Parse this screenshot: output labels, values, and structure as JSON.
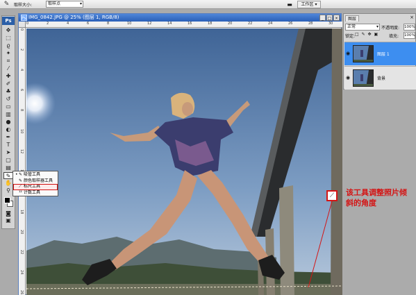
{
  "options_bar": {
    "tool_icon": "eyedropper-icon",
    "sample_size_label": "取样大小:",
    "sample_size_value": "取样点",
    "workspace_label": "工作区",
    "workspace_icon": "workspace-icon"
  },
  "toolbox": {
    "logo": "Ps",
    "tools": [
      "move-icon",
      "marquee-icon",
      "lasso-icon",
      "magic-wand-icon",
      "crop-icon",
      "slice-icon",
      "healing-brush-icon",
      "brush-icon",
      "clone-stamp-icon",
      "history-brush-icon",
      "eraser-icon",
      "gradient-icon",
      "blur-icon",
      "dodge-icon",
      "pen-icon",
      "type-icon",
      "path-select-icon",
      "shape-icon",
      "notes-icon",
      "eyedropper-icon",
      "hand-icon",
      "zoom-icon"
    ],
    "foreground_color": "#000000",
    "background_color": "#ffffff"
  },
  "flyout": {
    "items": [
      {
        "label": "吸管工具",
        "icon": "eyedropper-icon",
        "selected": false
      },
      {
        "label": "颜色取样器工具",
        "icon": "color-sampler-icon",
        "selected": false
      },
      {
        "label": "标尺工具",
        "icon": "ruler-icon",
        "selected": true
      },
      {
        "label": "计数工具",
        "icon": "count-icon",
        "selected": false
      }
    ]
  },
  "document": {
    "title": "IMG_0842.JPG @ 25% (图层 1, RGB/8)",
    "ruler_h": [
      "0",
      "2",
      "4",
      "6",
      "8",
      "10",
      "12",
      "14",
      "16",
      "18",
      "20",
      "22",
      "24",
      "26",
      "28",
      "30"
    ],
    "ruler_v": [
      "0",
      "2",
      "4",
      "6",
      "8",
      "10",
      "12",
      "14",
      "16",
      "18",
      "20",
      "22",
      "24",
      "26"
    ]
  },
  "layers_panel": {
    "tab": "图层",
    "close_label": "×",
    "blend_mode": "正常",
    "opacity_label": "不透明度:",
    "opacity_value": "100%",
    "lock_label": "锁定:",
    "fill_label": "填充:",
    "fill_value": "100%",
    "layers": [
      {
        "name": "图层 1",
        "selected": true,
        "visible": true
      },
      {
        "name": "背景",
        "selected": false,
        "visible": true
      }
    ]
  },
  "annotation": {
    "text": "该工具调整照片倾斜的角度",
    "color": "#d41515"
  }
}
